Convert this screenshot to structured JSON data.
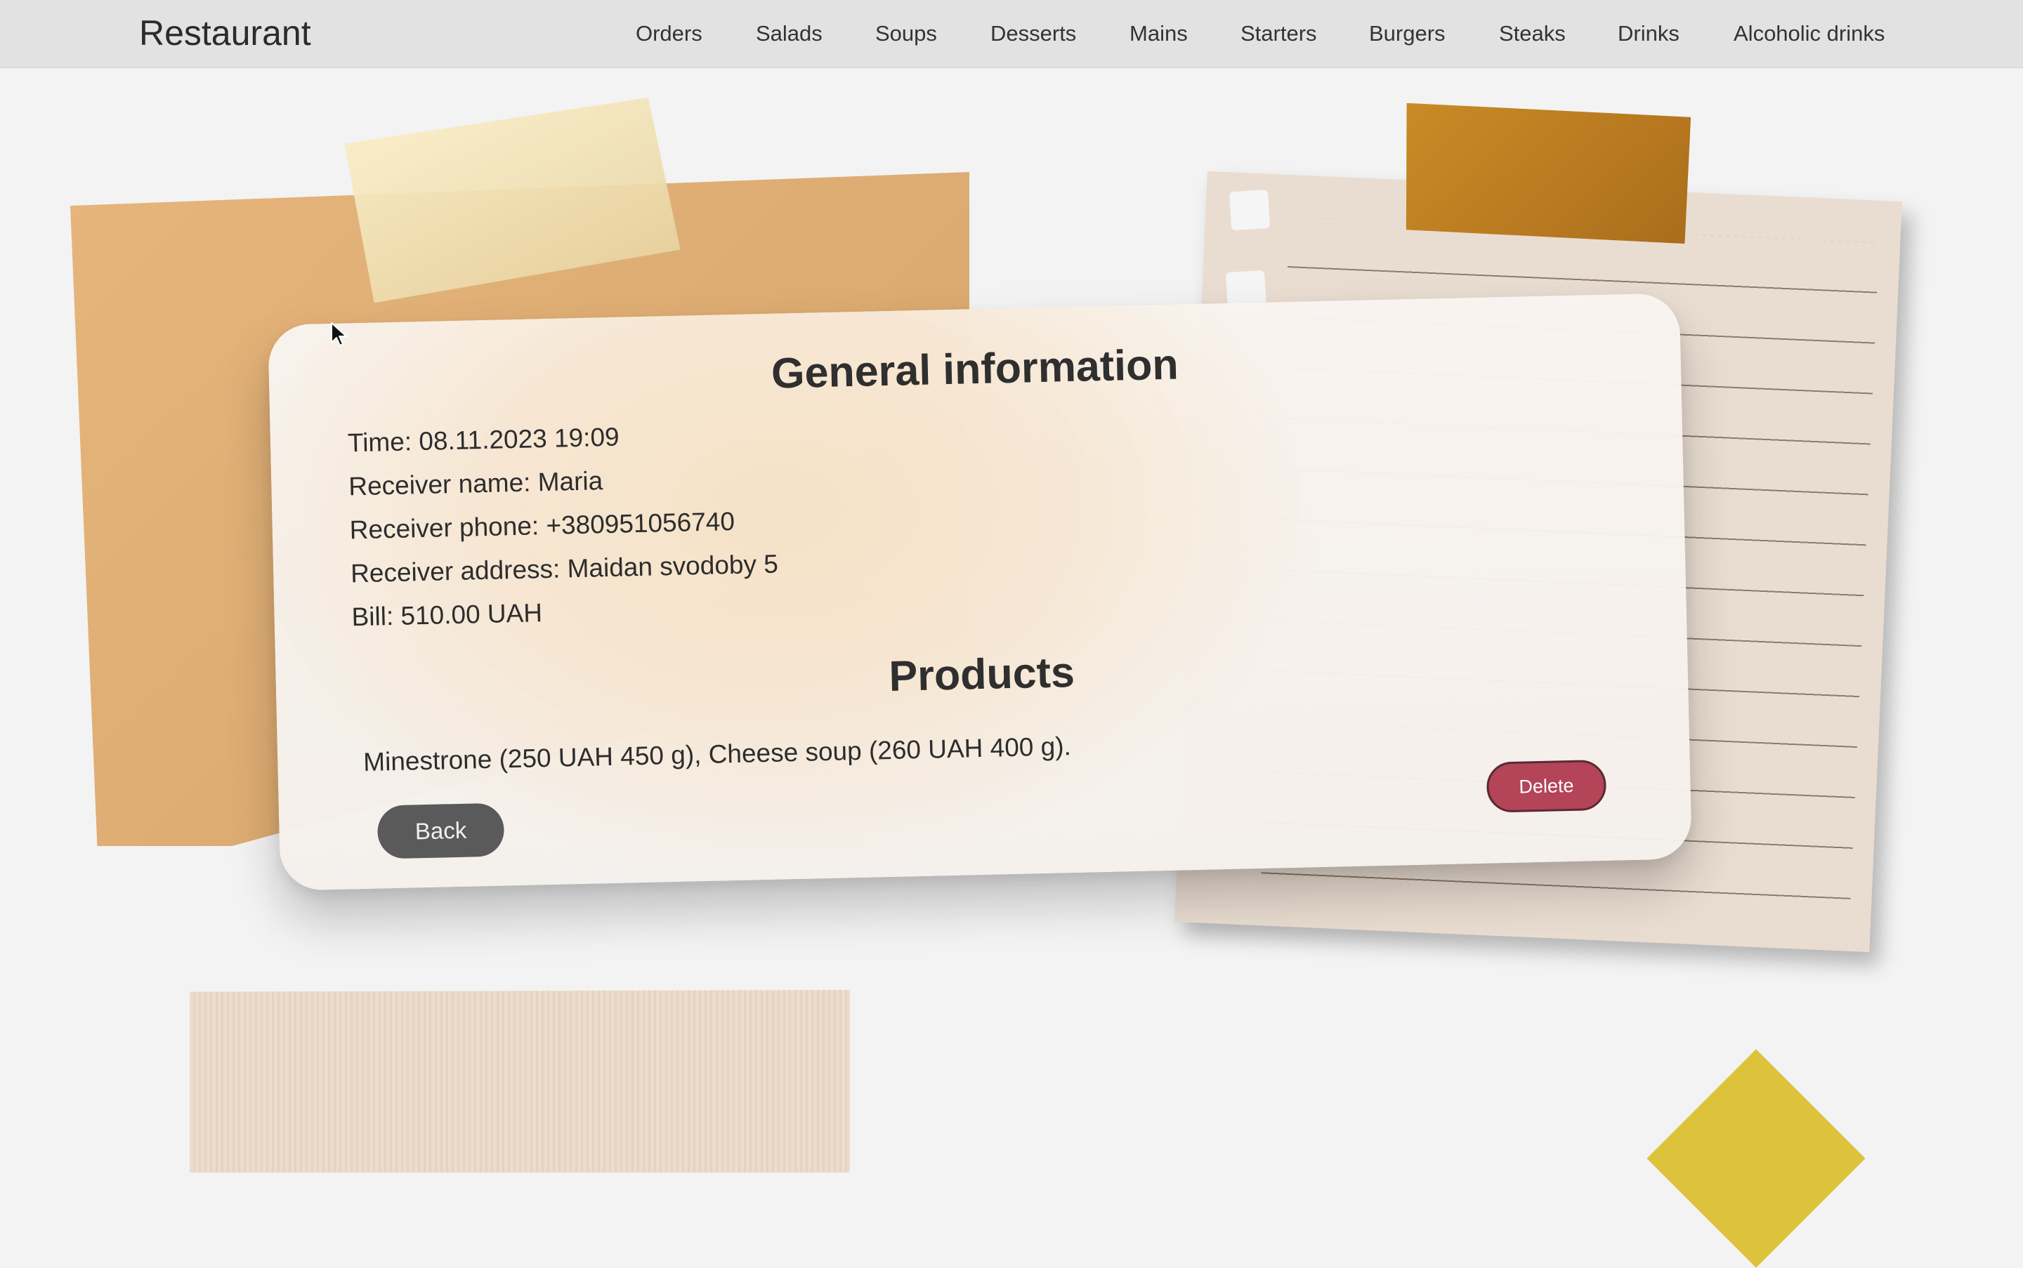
{
  "navbar": {
    "brand": "Restaurant",
    "links": [
      "Orders",
      "Salads",
      "Soups",
      "Desserts",
      "Mains",
      "Starters",
      "Burgers",
      "Steaks",
      "Drinks",
      "Alcoholic drinks"
    ]
  },
  "order": {
    "title": "General information",
    "time": "Time: 08.11.2023 19:09",
    "receiver_name": "Receiver name: Maria",
    "receiver_phone": "Receiver phone: +380951056740",
    "receiver_address": "Receiver address: Maidan svodoby 5",
    "bill": "Bill: 510.00 UAH",
    "products_title": "Products",
    "products_text": "Minestrone (250 UAH 450 g),  Cheese soup (260 UAH 400 g).",
    "back_label": "Back",
    "delete_label": "Delete"
  },
  "colors": {
    "navbar": "#e2e2e2",
    "delete_button": "#b44458",
    "back_button": "#5a5a5a"
  },
  "icons": {
    "cursor": "arrow-cursor-icon"
  }
}
